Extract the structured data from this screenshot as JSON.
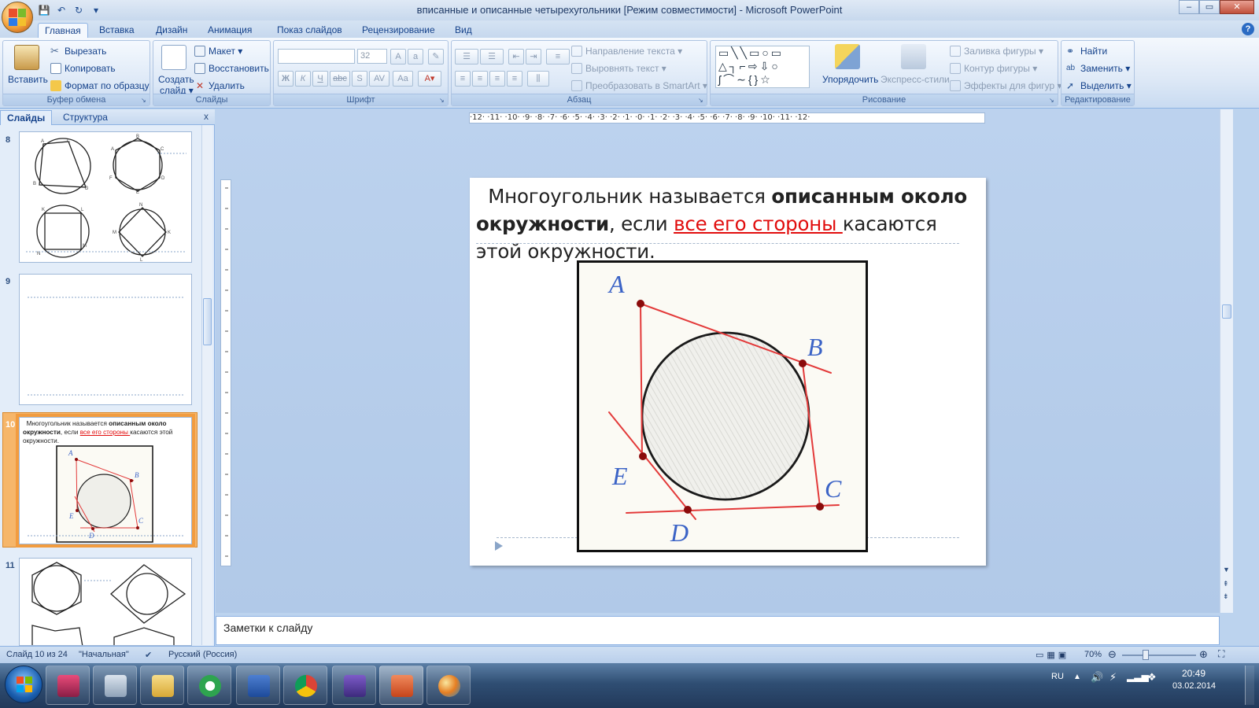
{
  "window": {
    "title": "вписанные и описанные четырехугольники [Режим совместимости] - Microsoft PowerPoint",
    "controls": {
      "minimize": "–",
      "maximize": "▭",
      "close": "✕"
    }
  },
  "quick_access": {
    "save": "💾",
    "undo": "↶",
    "redo": "↻",
    "customize": "▾"
  },
  "tabs": [
    "Главная",
    "Вставка",
    "Дизайн",
    "Анимация",
    "Показ слайдов",
    "Рецензирование",
    "Вид"
  ],
  "active_tab": "Главная",
  "ribbon": {
    "clipboard": {
      "label": "Буфер обмена",
      "paste": "Вставить",
      "cut": "Вырезать",
      "copy": "Копировать",
      "format_painter": "Формат по образцу"
    },
    "slides": {
      "label": "Слайды",
      "new_slide_line1": "Создать",
      "new_slide_line2": "слайд ▾",
      "layout": "Макет ▾",
      "reset": "Восстановить",
      "delete": "Удалить"
    },
    "font": {
      "label": "Шрифт",
      "font_name": "",
      "font_size": "32"
    },
    "paragraph": {
      "label": "Абзац",
      "text_direction": "Направление текста ▾",
      "align_text": "Выровнять текст ▾",
      "smartart": "Преобразовать в SmartArt ▾"
    },
    "drawing": {
      "label": "Рисование",
      "arrange": "Упорядочить",
      "quick_styles": "Экспресс-стили",
      "shape_fill": "Заливка фигуры ▾",
      "shape_outline": "Контур фигуры ▾",
      "shape_effects": "Эффекты для фигур ▾"
    },
    "editing": {
      "label": "Редактирование",
      "find": "Найти",
      "replace": "Заменить ▾",
      "select": "Выделить ▾"
    }
  },
  "panel": {
    "tab_slides": "Слайды",
    "tab_outline": "Структура",
    "close": "x",
    "thumbnails": [
      {
        "num": "8"
      },
      {
        "num": "9"
      },
      {
        "num": "10",
        "selected": true,
        "text_normal": "Многоугольник называется ",
        "text_bold": "описанным около окружности",
        "text_mid": ", если ",
        "text_red": "все его стороны ",
        "text_end": "касаются этой окружности."
      },
      {
        "num": "11"
      }
    ]
  },
  "rulers": {
    "horizontal": "·12·  ·11·  ·10·  ·9·  ·8·  ·7·  ·6·  ·5·  ·4·  ·3·  ·2·  ·1·  ·0·  ·1·  ·2·  ·3·  ·4·  ·5·  ·6·  ·7·  ·8·  ·9·  ·10·  ·11·  ·12·"
  },
  "slide": {
    "title_part1": "Многоугольник называется ",
    "title_bold": "описанным около окружности",
    "title_part2": ", если ",
    "title_red": "все его стороны ",
    "title_part3": "касаются этой окружности.",
    "figure_labels": {
      "A": "A",
      "B": "B",
      "C": "C",
      "D": "D",
      "E": "E"
    }
  },
  "notes": {
    "placeholder": "Заметки к слайду"
  },
  "statusbar": {
    "slide_info": "Слайд 10 из 24",
    "theme": "\"Начальная\"",
    "language": "Русский (Россия)",
    "zoom": "70%"
  },
  "taskbar": {
    "language": "RU",
    "time": "20:49",
    "date": "03.02.2014"
  },
  "colors": {
    "accent_red": "#e10d0d",
    "figure_line": "#e33a3a",
    "figure_point": "#8b0b0b",
    "letter_blue": "#3b63c6",
    "selected_thumb": "#f29c3f"
  }
}
